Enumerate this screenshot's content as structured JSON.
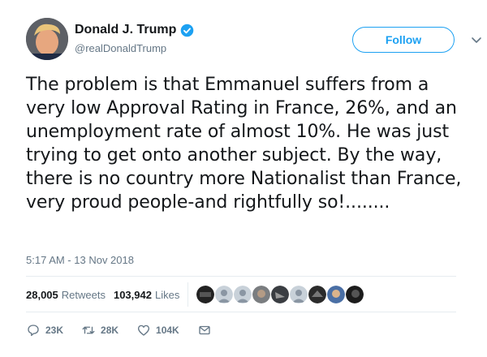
{
  "author": {
    "name": "Donald J. Trump",
    "handle": "@realDonaldTrump"
  },
  "follow_label": "Follow",
  "tweet": {
    "text": "The problem is that Emmanuel suffers from a very low Approval Rating in France, 26%, and an unemployment rate of almost 10%. He was just trying to get onto another subject. By the way, there is no country more Nationalist than France, very proud people-and rightfully so!........",
    "timestamp": "5:17 AM - 13 Nov 2018"
  },
  "stats": {
    "retweets_count": "28,005",
    "retweets_label": "Retweets",
    "likes_count": "103,942",
    "likes_label": "Likes"
  },
  "actions": {
    "reply_count": "23K",
    "retweet_count": "28K",
    "like_count": "104K"
  },
  "colors": {
    "accent": "#1da1f2",
    "text": "#14171a",
    "muted": "#657786",
    "divider": "#e6ecf0"
  }
}
